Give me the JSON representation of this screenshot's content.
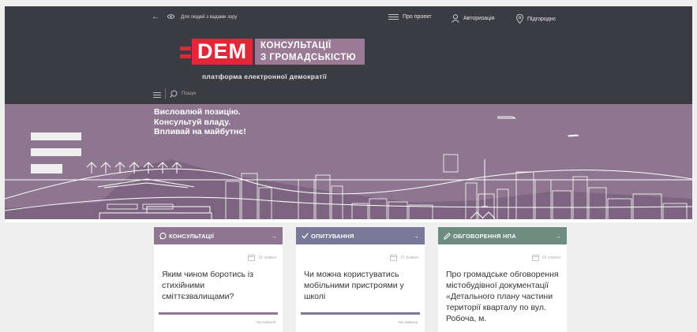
{
  "topbar": {
    "back_icon": "arrow-left-icon",
    "accessibility_icon": "eye-icon",
    "accessibility_label": "Для людей з вадами зору",
    "about_label": "Про проект",
    "login_label": "Авторизація",
    "city_label": "Підгороднє"
  },
  "logo": {
    "dem": "DEM",
    "line1": "КОНСУЛЬТАЦІЇ",
    "line2": "З ГРОМАДСЬКІСТЮ",
    "tagline": "платформа електронної демократії"
  },
  "search": {
    "placeholder": "Пошук"
  },
  "hero": {
    "line1": "Висловлюй позицію.",
    "line2": "Консультуй владу.",
    "line3": "Впливай на майбутнє!"
  },
  "cards": [
    {
      "label": "КОНСУЛЬТАЦІЇ",
      "icon": "speech-bubble-icon",
      "color": "#8e7590",
      "date": "16 травня",
      "title": "Яким чином боротись із стихійними сміттєзвалищами?",
      "footer": "Час вийшов"
    },
    {
      "label": "ОПИТУВАННЯ",
      "icon": "check-icon",
      "color": "#7a7898",
      "date": "15 травня",
      "title": "Чи можна користуватись мобільними пристроями у школі",
      "footer": "Час вийшов"
    },
    {
      "label": "ОБГОВОРЕННЯ НПА",
      "icon": "pen-icon",
      "color": "#6e8d80",
      "date": "03 серпня",
      "title": "Про громадське обговорення містобудівної документації «Детального плану частини території кварталу по вул. Робоча, м.",
      "footer": ""
    }
  ],
  "colors": {
    "topbar": "#3b3c41",
    "hero": "#8e7590",
    "brand_red": "#e4263a"
  }
}
